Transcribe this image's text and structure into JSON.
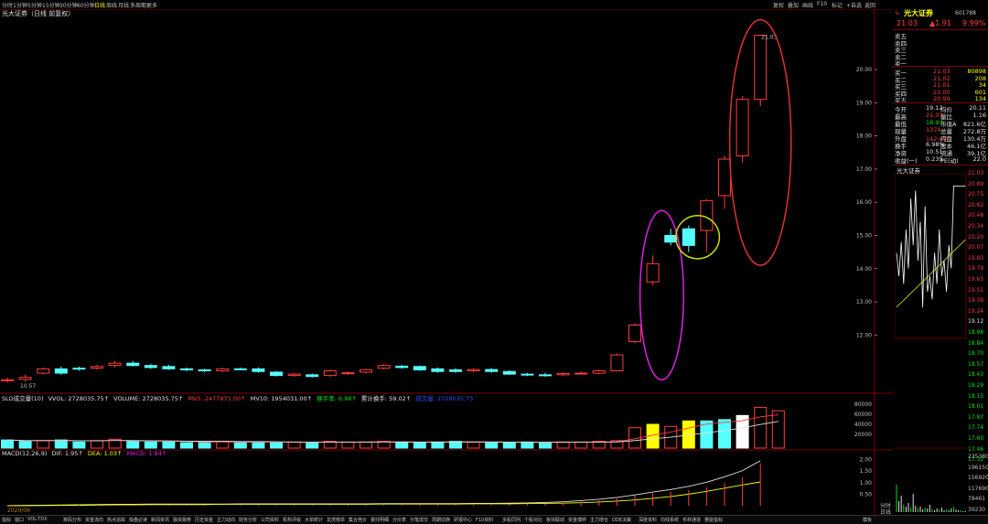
{
  "topbar": {
    "tabs": [
      "分时",
      "1分钟",
      "5分钟",
      "15分钟",
      "30分钟",
      "60分钟",
      "日线",
      "周线",
      "月线",
      "多周期",
      "更多"
    ],
    "active_tab": "日线",
    "right_tabs": [
      "复权",
      "叠加",
      "画线",
      "F10",
      "标记",
      "+自选",
      "返回"
    ]
  },
  "title": {
    "text": "光大证券（日线 前复权）"
  },
  "chart_data": {
    "type": "candlestick",
    "title": "光大证券（日线 前复权）",
    "y_ticks": [
      20.0,
      19.0,
      18.0,
      17.0,
      16.0,
      15.0,
      14.0,
      13.0,
      12.0
    ],
    "ylim": [
      10.3,
      21.6
    ],
    "high_label": "21.03",
    "low_label": "10.57",
    "candles": [
      {
        "o": 10.62,
        "c": 10.65,
        "h": 10.72,
        "l": 10.57,
        "up": true
      },
      {
        "o": 10.66,
        "c": 10.72,
        "h": 10.8,
        "l": 10.6,
        "up": true
      },
      {
        "o": 10.85,
        "c": 10.98,
        "h": 11.02,
        "l": 10.8,
        "up": true
      },
      {
        "o": 10.98,
        "c": 10.85,
        "h": 11.05,
        "l": 10.8,
        "up": false
      },
      {
        "o": 10.98,
        "c": 11.0,
        "h": 11.05,
        "l": 10.92,
        "up": false
      },
      {
        "o": 11.0,
        "c": 11.05,
        "h": 11.1,
        "l": 10.95,
        "up": true
      },
      {
        "o": 11.08,
        "c": 11.15,
        "h": 11.22,
        "l": 11.02,
        "up": true
      },
      {
        "o": 11.15,
        "c": 11.08,
        "h": 11.22,
        "l": 11.05,
        "up": false
      },
      {
        "o": 11.08,
        "c": 11.02,
        "h": 11.12,
        "l": 10.98,
        "up": false
      },
      {
        "o": 11.05,
        "c": 10.98,
        "h": 11.1,
        "l": 10.95,
        "up": false
      },
      {
        "o": 10.98,
        "c": 10.95,
        "h": 11.02,
        "l": 10.9,
        "up": false
      },
      {
        "o": 10.95,
        "c": 10.92,
        "h": 10.98,
        "l": 10.88,
        "up": false
      },
      {
        "o": 10.92,
        "c": 10.98,
        "h": 11.02,
        "l": 10.88,
        "up": true
      },
      {
        "o": 10.98,
        "c": 10.98,
        "h": 11.02,
        "l": 10.94,
        "up": false
      },
      {
        "o": 10.98,
        "c": 10.9,
        "h": 11.02,
        "l": 10.86,
        "up": false
      },
      {
        "o": 10.88,
        "c": 10.78,
        "h": 10.92,
        "l": 10.75,
        "up": false
      },
      {
        "o": 10.78,
        "c": 10.82,
        "h": 10.86,
        "l": 10.74,
        "up": true
      },
      {
        "o": 10.8,
        "c": 10.75,
        "h": 10.84,
        "l": 10.72,
        "up": false
      },
      {
        "o": 10.78,
        "c": 10.92,
        "h": 10.96,
        "l": 10.74,
        "up": true
      },
      {
        "o": 10.84,
        "c": 10.86,
        "h": 10.9,
        "l": 10.8,
        "up": true
      },
      {
        "o": 10.88,
        "c": 10.95,
        "h": 10.98,
        "l": 10.84,
        "up": true
      },
      {
        "o": 11.0,
        "c": 11.08,
        "h": 11.12,
        "l": 10.96,
        "up": true
      },
      {
        "o": 11.06,
        "c": 11.02,
        "h": 11.1,
        "l": 10.98,
        "up": false
      },
      {
        "o": 11.05,
        "c": 10.95,
        "h": 11.08,
        "l": 10.92,
        "up": false
      },
      {
        "o": 10.98,
        "c": 10.9,
        "h": 11.02,
        "l": 10.86,
        "up": false
      },
      {
        "o": 10.95,
        "c": 10.9,
        "h": 11.0,
        "l": 10.86,
        "up": false
      },
      {
        "o": 10.92,
        "c": 10.96,
        "h": 11.0,
        "l": 10.88,
        "up": true
      },
      {
        "o": 10.96,
        "c": 10.9,
        "h": 11.0,
        "l": 10.86,
        "up": false
      },
      {
        "o": 10.9,
        "c": 10.82,
        "h": 10.94,
        "l": 10.8,
        "up": false
      },
      {
        "o": 10.82,
        "c": 10.8,
        "h": 10.86,
        "l": 10.76,
        "up": false
      },
      {
        "o": 10.8,
        "c": 10.78,
        "h": 10.86,
        "l": 10.74,
        "up": false
      },
      {
        "o": 10.8,
        "c": 10.84,
        "h": 10.88,
        "l": 10.76,
        "up": true
      },
      {
        "o": 10.84,
        "c": 10.85,
        "h": 10.9,
        "l": 10.8,
        "up": true
      },
      {
        "o": 10.85,
        "c": 10.92,
        "h": 10.96,
        "l": 10.82,
        "up": true
      },
      {
        "o": 10.92,
        "c": 11.4,
        "h": 11.45,
        "l": 10.9,
        "up": true
      },
      {
        "o": 11.8,
        "c": 12.3,
        "h": 12.35,
        "l": 11.75,
        "up": true
      },
      {
        "o": 13.6,
        "c": 14.15,
        "h": 14.4,
        "l": 13.5,
        "up": true
      },
      {
        "o": 15.0,
        "c": 14.8,
        "h": 15.2,
        "l": 14.7,
        "up": false
      },
      {
        "o": 15.2,
        "c": 14.7,
        "h": 15.3,
        "l": 14.5,
        "up": false
      },
      {
        "o": 15.15,
        "c": 16.05,
        "h": 16.1,
        "l": 14.5,
        "up": true
      },
      {
        "o": 16.2,
        "c": 17.3,
        "h": 17.4,
        "l": 15.8,
        "up": true
      },
      {
        "o": 17.4,
        "c": 19.1,
        "h": 19.2,
        "l": 17.2,
        "up": true
      },
      {
        "o": 19.1,
        "c": 21.03,
        "h": 21.03,
        "l": 18.9,
        "up": true
      }
    ],
    "volume_ticks": [
      "80000",
      "60000",
      "40000",
      "20000"
    ],
    "volume_values": [
      12,
      10,
      11,
      12,
      9,
      11,
      13,
      10,
      9,
      9,
      8,
      9,
      10,
      8,
      9,
      8,
      9,
      8,
      10,
      9,
      9,
      10,
      9,
      8,
      9,
      10,
      9,
      8,
      8,
      9,
      8,
      9,
      9,
      10,
      11,
      30,
      35,
      32,
      40,
      40,
      42,
      48,
      60,
      55
    ],
    "volume_colors": [
      "cyan",
      "cyan",
      "red",
      "cyan",
      "cyan",
      "red",
      "red",
      "cyan",
      "cyan",
      "cyan",
      "cyan",
      "cyan",
      "red",
      "cyan",
      "cyan",
      "cyan",
      "red",
      "cyan",
      "red",
      "red",
      "red",
      "red",
      "cyan",
      "cyan",
      "cyan",
      "cyan",
      "red",
      "cyan",
      "cyan",
      "cyan",
      "cyan",
      "red",
      "red",
      "red",
      "red",
      "red",
      "yellow",
      "red",
      "yellow",
      "cyan",
      "cyan",
      "white",
      "red",
      "red"
    ],
    "macd_ticks": [
      "2.00",
      "1.50",
      "1.00",
      "0.50"
    ],
    "macd_dif": [
      0,
      0.01,
      0.02,
      0.03,
      0.04,
      0.05,
      0.06,
      0.06,
      0.07,
      0.07,
      0.07,
      0.07,
      0.07,
      0.08,
      0.08,
      0.08,
      0.08,
      0.08,
      0.08,
      0.08,
      0.08,
      0.09,
      0.09,
      0.09,
      0.09,
      0.09,
      0.1,
      0.1,
      0.11,
      0.12,
      0.14,
      0.17,
      0.22,
      0.28,
      0.36,
      0.47,
      0.59,
      0.7,
      0.84,
      1.02,
      1.25,
      1.52,
      1.95
    ],
    "macd_dea": [
      0,
      0.005,
      0.01,
      0.015,
      0.02,
      0.03,
      0.04,
      0.04,
      0.05,
      0.05,
      0.05,
      0.05,
      0.06,
      0.06,
      0.06,
      0.06,
      0.06,
      0.06,
      0.06,
      0.06,
      0.06,
      0.07,
      0.07,
      0.07,
      0.07,
      0.07,
      0.08,
      0.08,
      0.08,
      0.09,
      0.1,
      0.11,
      0.13,
      0.16,
      0.2,
      0.25,
      0.32,
      0.4,
      0.5,
      0.62,
      0.76,
      0.9,
      1.03
    ]
  },
  "volume_header": {
    "name": "SLO成交量(10)",
    "vvol": "VVOL: 2728035.75↑",
    "volume": "VOLUME: 2728035.75↑",
    "mv5": "MV5: 2477871.00↑",
    "mv10": "MV10: 1954031.00↑",
    "turnover": "换手率: 6.98↑",
    "cum_turnover": "累计换手: 59.02↑",
    "extra": "成交量: 2728035.75"
  },
  "macd_header": {
    "name": "MACD(12,26,9)",
    "dif": "DIF: 1.95↑",
    "dea": "DEA: 1.03↑",
    "macd": "MACD: 1.84↑"
  },
  "bottom_date": "2020/06",
  "bottombar": {
    "tabs": [
      "指标",
      "窗口",
      "VOL-TDX",
      "筹码分布",
      "资金流向",
      "热点追踪",
      "操盘必读",
      "新闻资讯",
      "融资融券",
      "历史资金",
      "主力动向",
      "财务分析",
      "公司资料",
      "机构评级",
      "大单统计",
      "龙虎榜单",
      "集合竞价",
      "委托明细",
      "分价表",
      "分笔成交",
      "周期切换",
      "研报中心",
      "F10资料",
      "多股同列",
      "个股对比",
      "板块联动",
      "资金博弈",
      "主力增仓",
      "DDE决策",
      "深度资料",
      "均线系统",
      "布林通道",
      "量能指标"
    ],
    "right": "模板"
  },
  "panel": {
    "stock_name": "光大证券",
    "stock_code": "601788",
    "price": "21.03",
    "change": "▲1.91",
    "pct": "9.99%",
    "sells": [
      {
        "label": "卖五",
        "price": "",
        "vol": ""
      },
      {
        "label": "卖四",
        "price": "",
        "vol": ""
      },
      {
        "label": "卖三",
        "price": "",
        "vol": ""
      },
      {
        "label": "卖二",
        "price": "",
        "vol": ""
      },
      {
        "label": "卖一",
        "price": "",
        "vol": ""
      }
    ],
    "buys": [
      {
        "label": "买一",
        "price": "21.03",
        "vol": "80898"
      },
      {
        "label": "买二",
        "price": "21.02",
        "vol": "208"
      },
      {
        "label": "买三",
        "price": "21.01",
        "vol": "34"
      },
      {
        "label": "买四",
        "price": "21.00",
        "vol": "601"
      },
      {
        "label": "买五",
        "price": "20.99",
        "vol": "134"
      }
    ],
    "stats": [
      {
        "k1": "今开",
        "v1": "19.12",
        "k2": "均价",
        "v2": "20.11"
      },
      {
        "k1": "最高",
        "v1": "21.03",
        "k2": "量比",
        "v2": "1.16"
      },
      {
        "k1": "最低",
        "v1": "18.93",
        "k2": "市值A",
        "v2": "821.6亿"
      },
      {
        "k1": "现量",
        "v1": "1374",
        "k2": "总量",
        "v2": "272.8万"
      },
      {
        "k1": "外盘",
        "v1": "142.4万",
        "k2": "内盘",
        "v2": "130.4万"
      },
      {
        "k1": "换手",
        "v1": "6.98%",
        "k2": "股本",
        "v2": "46.1亿"
      },
      {
        "k1": "净资",
        "v1": "10.51",
        "k2": "流通",
        "v2": "39.1亿"
      },
      {
        "k1": "收益(一)",
        "v1": "0.239",
        "k2": "PE(动)",
        "v2": "22.0"
      }
    ],
    "mini_title": "光大证券",
    "mini_prices": [
      "21.03",
      "20.89",
      "20.75",
      "20.62",
      "20.48",
      "20.34",
      "20.20",
      "20.07",
      "19.93",
      "19.79",
      "19.65",
      "19.51",
      "19.38",
      "19.24",
      "19.12",
      "18.98",
      "18.84",
      "18.70",
      "18.57",
      "18.43",
      "18.29",
      "18.15",
      "18.01",
      "17.87",
      "17.74",
      "17.60",
      "17.46",
      "17.32"
    ],
    "mini_vol": [
      "235380",
      "196150",
      "156920",
      "117690",
      "78461",
      "39230"
    ],
    "mini_tabs": [
      "日线",
      "分时"
    ]
  },
  "colors": {
    "up": "#ff3c3c",
    "down": "#54ffff",
    "grid": "#7a0000",
    "magenta_circle": "#e020e0",
    "yellow_circle": "#c8e000",
    "red_circle": "#e03030"
  }
}
